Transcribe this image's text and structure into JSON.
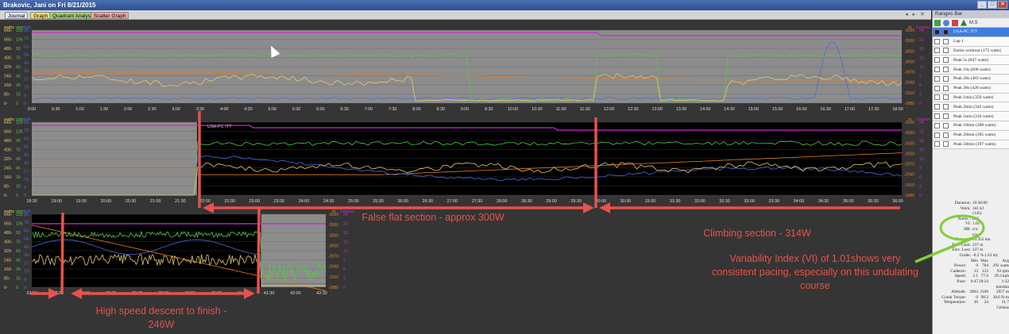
{
  "window": {
    "title": "Brakovic, Jani on Fri 8/21/2015"
  },
  "tabs": [
    {
      "label": "Journal",
      "bg": "#dfe8f7"
    },
    {
      "label": "Graph",
      "bg": "#f4e06b"
    },
    {
      "label": "Quadrant Analysis",
      "bg": "#9fd36f"
    },
    {
      "label": "Scatter Graph",
      "bg": "#f1a2a2"
    }
  ],
  "colors": {
    "power": "#e8c76a",
    "cadence": "#55c94d",
    "speed": "#4d6ae0",
    "hr": "#c72bd4",
    "altitude": "#e07d2b",
    "annotation": "#e8524a",
    "callout": "#7fce3b"
  },
  "axis_units": {
    "watts": "watts",
    "rpm": "rpm",
    "kph": "kph",
    "m": "m",
    "celsius": "Celsius"
  },
  "chart_data": [
    {
      "type": "line",
      "x_ticks": [
        "0:00",
        "0:30",
        "1:00",
        "1:30",
        "2:00",
        "2:30",
        "3:00",
        "3:30",
        "4:00",
        "4:30",
        "5:00",
        "5:30",
        "6:00",
        "6:30",
        "7:00",
        "7:30",
        "8:00",
        "8:30",
        "9:00",
        "9:30",
        "10:00",
        "10:30",
        "11:00",
        "11:30",
        "12:00",
        "12:30",
        "13:00",
        "13:30",
        "14:00",
        "14:30",
        "15:00",
        "15:30",
        "16:00",
        "16:30",
        "17:00",
        "17:30",
        "18:00"
      ],
      "y_watts": [
        "0-",
        "80-",
        "160-",
        "240-",
        "320-",
        "400-",
        "480-",
        "560-",
        "640-"
      ],
      "y_rpm": [
        "0",
        "15",
        "30",
        "45",
        "60",
        "75",
        "90",
        "105",
        "120"
      ],
      "y_kph": [
        "0-",
        "9-",
        "18-",
        "27-",
        "36-",
        "45-",
        "54-",
        "63-",
        "72-",
        "81-"
      ],
      "y_alt": [
        "-2880",
        "-2910",
        "-2940",
        "-2970",
        "-3000",
        "-3030",
        "-3060",
        "-3090"
      ],
      "y_temp": [
        "0",
        "3",
        "6",
        "9",
        "12",
        "15",
        "18",
        "21",
        "24"
      ]
    },
    {
      "type": "line",
      "title": "USA-PC ITT",
      "x_ticks": [
        "18:30",
        "19:00",
        "19:30",
        "20:00",
        "20:30",
        "21:00",
        "21:30",
        "22:00",
        "22:30",
        "23:00",
        "23:30",
        "24:00",
        "24:30",
        "25:00",
        "25:30",
        "26:00",
        "26:30",
        "27:00",
        "27:30",
        "28:00",
        "28:30",
        "29:00",
        "29:30",
        "30:00",
        "30:30",
        "31:00",
        "31:30",
        "32:00",
        "32:30",
        "33:00",
        "33:30",
        "34:00",
        "34:30",
        "35:00",
        "35:30",
        "36:00"
      ],
      "y_watts": [
        "0-",
        "80-",
        "160-",
        "240-",
        "320-",
        "400-",
        "480-",
        "560-",
        "640-"
      ],
      "y_rpm": [
        "0",
        "15",
        "30",
        "45",
        "60",
        "75",
        "90",
        "105",
        "120"
      ],
      "y_kph": [
        "0-",
        "9-",
        "18-",
        "27-",
        "36-",
        "45-",
        "54-",
        "63-",
        "72-",
        "81-"
      ],
      "y_alt": [
        "-2880",
        "-2910",
        "-2940",
        "-2970",
        "-3000",
        "-3030",
        "-3060",
        "-3090"
      ],
      "y_temp": [
        "0",
        "3",
        "6",
        "9",
        "12",
        "15",
        "18",
        "21",
        "24"
      ]
    },
    {
      "type": "line",
      "x_ticks": [
        "37:00",
        "37:30",
        "38:00",
        "38:30",
        "39:00",
        "39:30",
        "40:00",
        "40:30",
        "41:00",
        "41:30",
        "42:00",
        "42:30"
      ],
      "y_watts": [
        "0-",
        "80-",
        "160-",
        "240-",
        "320-",
        "400-",
        "480-",
        "560-",
        "640-"
      ],
      "y_rpm": [
        "0",
        "15",
        "30",
        "45",
        "60",
        "75",
        "90",
        "105",
        "120"
      ],
      "y_kph": [
        "0-",
        "9-",
        "18-",
        "27-",
        "36-",
        "45-",
        "54-",
        "63-",
        "72-",
        "81-"
      ],
      "y_alt": [
        "-2880",
        "-2910",
        "-2940",
        "-2970",
        "-3000",
        "-3030",
        "-3060",
        "-3090"
      ],
      "y_temp": [
        "0",
        "3",
        "6",
        "9",
        "12",
        "15",
        "18",
        "21",
        "24"
      ]
    }
  ],
  "ranges_bar": {
    "title": "Ranges Bar",
    "toolbar_label": "M.S",
    "items": [
      {
        "label": "USA-PC ITT",
        "selected": true
      },
      {
        "label": "Lap 1"
      },
      {
        "label": "Entire workout (175 watts)"
      },
      {
        "label": "Peak 5s (647 watts)"
      },
      {
        "label": "Peak 10s (606 watts)"
      },
      {
        "label": "Peak 20s (483 watts)"
      },
      {
        "label": "Peak 30s (428 watts)"
      },
      {
        "label": "Peak 1min (350 watts)"
      },
      {
        "label": "Peak 2min (342 watts)"
      },
      {
        "label": "Peak 5min (316 watts)"
      },
      {
        "label": "Peak 10min (308 watts)"
      },
      {
        "label": "Peak 20min (285 watts)"
      },
      {
        "label": "Peak 50min (197 watts)"
      }
    ]
  },
  "stats": {
    "rows": [
      {
        "label": "Duration:",
        "value": "19:30:00"
      },
      {
        "label": "Work:",
        "value": "341 kJ"
      },
      {
        "label": "",
        "value": "(145)"
      },
      {
        "label": "Norm...",
        "value": "296"
      },
      {
        "label": "VI:",
        "value": "1.01"
      },
      {
        "label": "HR:",
        "value": "n/a"
      },
      {
        "label": "",
        "value": "n/a"
      },
      {
        "label": "Distance:",
        "value": "13.352 km"
      },
      {
        "label": "Elev. Gain:",
        "value": "237 m"
      },
      {
        "label": "Elev. Loss:",
        "value": "237 m"
      },
      {
        "label": "Grade:",
        "value": "-0.2 % (-23 m)"
      }
    ],
    "table_header": [
      "",
      "Min",
      "Max",
      "Avg"
    ],
    "table": [
      [
        "Power:",
        "0",
        "704",
        "292 watts"
      ],
      [
        "Cadence:",
        "13",
        "123",
        "93 rpm"
      ],
      [
        "Speed:",
        "2.1",
        "77.6",
        "39.2 kph"
      ],
      [
        "Pace:",
        "0:47",
        "28:34",
        "1:32 min/km"
      ],
      [
        "Altitude:",
        "2863",
        "3100",
        "2957 m"
      ],
      [
        "Crank Torque:",
        "0",
        "90.2",
        "30.6 N-m"
      ],
      [
        "Temperature:",
        "20",
        "24",
        "21.7 Celsius"
      ]
    ]
  },
  "annotations": {
    "false_flat": "False flat section - approx 300W",
    "climbing": "Climbing section - 314W",
    "descent": "High speed descent to finish - 246W",
    "vi_note": "Variability Index  (VI) of 1.01shows very consistent pacing, especially on this undulating course"
  }
}
